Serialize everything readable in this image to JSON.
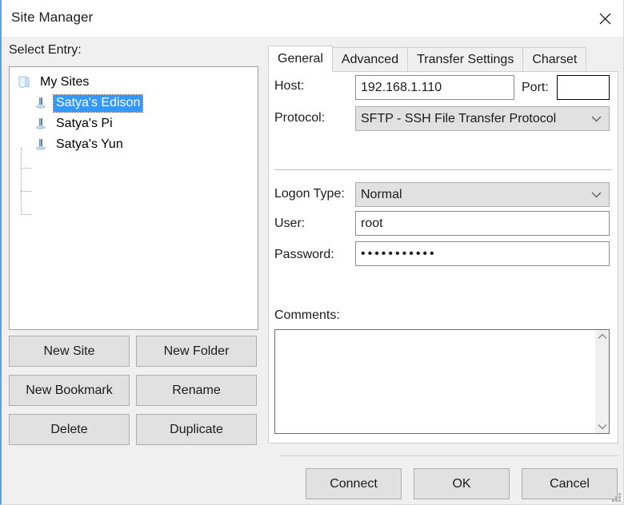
{
  "window": {
    "title": "Site Manager",
    "close_icon": "close-icon",
    "accent_selection_color": "#3399ff",
    "dialog_background": "#f0f0f0",
    "panel_background": "#ffffff"
  },
  "left": {
    "select_entry_label": "Select Entry:",
    "tree": {
      "root": {
        "label": "My Sites",
        "icon": "folder-icon"
      },
      "items": [
        {
          "label": "Satya's Edison",
          "icon": "site-icon",
          "selected": true
        },
        {
          "label": "Satya's Pi",
          "icon": "site-icon",
          "selected": false
        },
        {
          "label": "Satya's Yun",
          "icon": "site-icon",
          "selected": false
        }
      ]
    },
    "buttons": [
      {
        "label": "New Site"
      },
      {
        "label": "New Folder"
      },
      {
        "label": "New Bookmark"
      },
      {
        "label": "Rename"
      },
      {
        "label": "Delete"
      },
      {
        "label": "Duplicate"
      }
    ]
  },
  "right": {
    "tabs": [
      {
        "label": "General",
        "active": true
      },
      {
        "label": "Advanced",
        "active": false
      },
      {
        "label": "Transfer Settings",
        "active": false
      },
      {
        "label": "Charset",
        "active": false
      }
    ],
    "general": {
      "host_label": "Host:",
      "host_value": "192.168.1.110",
      "host_placeholder": "",
      "port_label": "Port:",
      "port_value": "",
      "port_placeholder": "",
      "protocol_label": "Protocol:",
      "protocol_value": "SFTP - SSH File Transfer Protocol",
      "logon_type_label": "Logon Type:",
      "logon_type_value": "Normal",
      "user_label": "User:",
      "user_value": "root",
      "user_placeholder": "",
      "password_label": "Password:",
      "password_value": "•••••••••••",
      "comments_label": "Comments:",
      "comments_value": "",
      "comments_placeholder": "",
      "dropdown_icon": "chevron-down-icon",
      "scroll_up_icon": "chevron-up-icon",
      "scroll_down_icon": "chevron-down-icon"
    }
  },
  "footer": {
    "buttons": [
      {
        "label": "Connect"
      },
      {
        "label": "OK"
      },
      {
        "label": "Cancel"
      }
    ],
    "resize_grip_icon": "resize-grip-icon"
  }
}
